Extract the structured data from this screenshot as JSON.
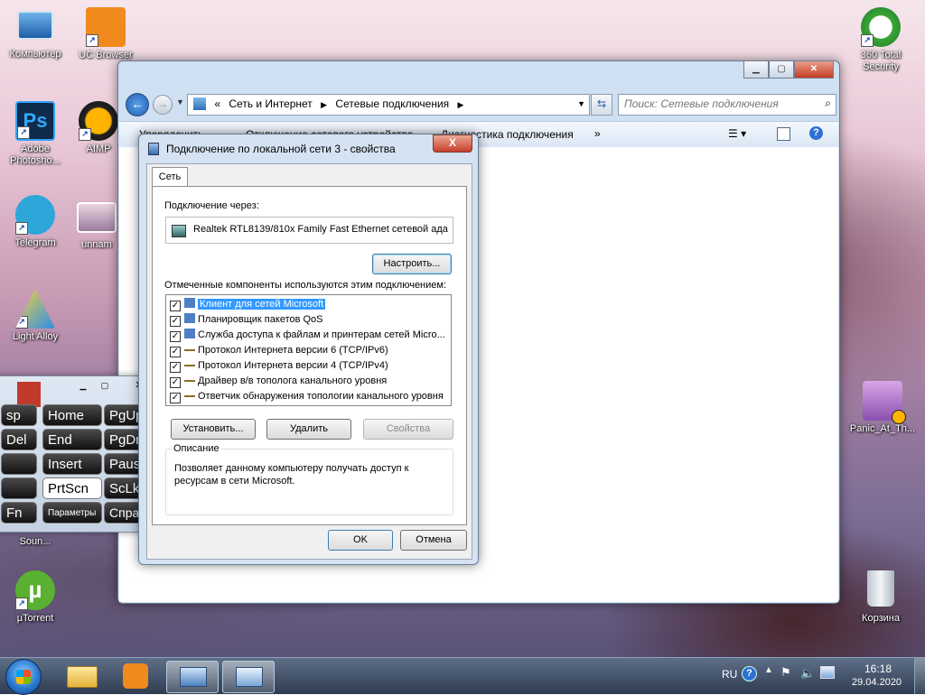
{
  "desktop_icons": {
    "computer": "Компьютер",
    "uc_browser": "UC Browser",
    "total_security": "360 Total Security",
    "photoshop": "Adobe Photosho...",
    "aimp": "AIMP",
    "telegram": "Telegram",
    "unnamed": "unnam",
    "light_alloy": "Light Alloy",
    "panic": "Panic_At_Th...",
    "sound": "Soun...",
    "utorrent": "µTorrent",
    "recycle": "Корзина"
  },
  "explorer": {
    "breadcrumb_prefix": "«",
    "breadcrumb_1": "Сеть и Интернет",
    "breadcrumb_2": "Сетевые подключения",
    "search_placeholder": "Поиск: Сетевые подключения",
    "toolbar": {
      "organize": "Упорядочить",
      "disable": "Отключение сетевого устройства",
      "diagnose": "Диагностика подключения",
      "more": "»"
    }
  },
  "dialog": {
    "title": "Подключение по локальной сети 3 - свойства",
    "tab": "Сеть",
    "connect_using_label": "Подключение через:",
    "adapter": "Realtek RTL8139/810x Family Fast Ethernet сетевой ада",
    "configure_button": "Настроить...",
    "components_label": "Отмеченные компоненты используются этим подключением:",
    "components": [
      {
        "label": "Клиент для сетей Microsoft",
        "checked": true,
        "selected": true
      },
      {
        "label": "Планировщик пакетов QoS",
        "checked": true,
        "selected": false
      },
      {
        "label": "Служба доступа к файлам и принтерам сетей Micro...",
        "checked": true,
        "selected": false
      },
      {
        "label": "Протокол Интернета версии 6 (TCP/IPv6)",
        "checked": true,
        "selected": false
      },
      {
        "label": "Протокол Интернета версии 4 (TCP/IPv4)",
        "checked": true,
        "selected": false
      },
      {
        "label": "Драйвер в/в тополога канального уровня",
        "checked": true,
        "selected": false
      },
      {
        "label": "Ответчик обнаружения топологии канального уровня",
        "checked": true,
        "selected": false
      }
    ],
    "install_button": "Установить...",
    "uninstall_button": "Удалить",
    "properties_button": "Свойства",
    "description_legend": "Описание",
    "description_text": "Позволяет данному компьютеру получать доступ к ресурсам в сети Microsoft.",
    "ok_button": "OK",
    "cancel_button": "Отмена",
    "close_glyph": "X"
  },
  "osk": {
    "keys": [
      {
        "label": "sp",
        "name": "key-backspace"
      },
      {
        "label": "Home",
        "name": "key-home"
      },
      {
        "label": "PgUp",
        "name": "key-pgup"
      },
      {
        "label": "Del",
        "name": "key-del"
      },
      {
        "label": "End",
        "name": "key-end"
      },
      {
        "label": "PgDn",
        "name": "key-pgdn"
      },
      {
        "label": "",
        "name": "key-blank-1"
      },
      {
        "label": "Insert",
        "name": "key-insert"
      },
      {
        "label": "Pause",
        "name": "key-pause"
      },
      {
        "label": "",
        "name": "key-blank-2"
      },
      {
        "label": "PrtScn",
        "name": "key-prtscn"
      },
      {
        "label": "ScLk",
        "name": "key-sclk"
      },
      {
        "label": "Fn",
        "name": "key-fn"
      },
      {
        "label": "Параметры",
        "name": "key-options"
      },
      {
        "label": "Справка",
        "name": "key-help"
      }
    ]
  },
  "taskbar": {
    "language": "RU",
    "time": "16:18",
    "date": "29.04.2020"
  }
}
